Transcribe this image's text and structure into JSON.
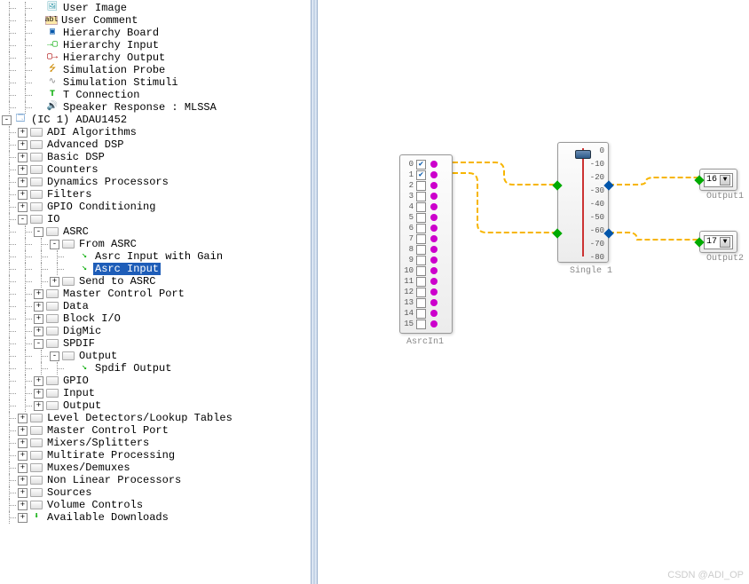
{
  "tree": {
    "misc": [
      {
        "icon": "img",
        "label": "User Image"
      },
      {
        "icon": "abl",
        "label": "User Comment"
      },
      {
        "icon": "hb",
        "label": "Hierarchy Board"
      },
      {
        "icon": "hi",
        "label": "Hierarchy Input"
      },
      {
        "icon": "ho",
        "label": "Hierarchy Output"
      },
      {
        "icon": "sp",
        "label": "Simulation Probe"
      },
      {
        "icon": "ss",
        "label": "Simulation Stimuli"
      },
      {
        "icon": "tc",
        "label": "T Connection"
      },
      {
        "icon": "spk",
        "label": "Speaker Response : MLSSA"
      }
    ],
    "chip": {
      "label": "(IC 1) ADAU1452",
      "exp": "-"
    },
    "chip_children": [
      {
        "exp": "+",
        "label": "ADI Algorithms"
      },
      {
        "exp": "+",
        "label": "Advanced DSP"
      },
      {
        "exp": "+",
        "label": "Basic DSP"
      },
      {
        "exp": "+",
        "label": "Counters"
      },
      {
        "exp": "+",
        "label": "Dynamics Processors"
      },
      {
        "exp": "+",
        "label": "Filters"
      },
      {
        "exp": "+",
        "label": "GPIO Conditioning"
      }
    ],
    "io": {
      "exp": "-",
      "label": "IO"
    },
    "asrc": {
      "exp": "-",
      "label": "ASRC"
    },
    "from_asrc": {
      "exp": "-",
      "label": "From ASRC"
    },
    "asrc_gain": {
      "label": "Asrc Input with Gain"
    },
    "asrc_input": {
      "label": "Asrc Input"
    },
    "send_asrc": {
      "exp": "+",
      "label": "Send to ASRC"
    },
    "io_tail": [
      {
        "exp": "+",
        "label": "Master Control Port"
      },
      {
        "exp": "+",
        "label": "Data"
      },
      {
        "exp": "+",
        "label": "Block I/O"
      },
      {
        "exp": "+",
        "label": "DigMic"
      }
    ],
    "spdif": {
      "exp": "-",
      "label": "SPDIF"
    },
    "spdif_out": {
      "exp": "-",
      "label": "Output"
    },
    "spdif_output_leaf": {
      "label": "Spdif Output"
    },
    "io_tail2": [
      {
        "exp": "+",
        "label": "GPIO"
      },
      {
        "exp": "+",
        "label": "Input"
      },
      {
        "exp": "+",
        "label": "Output"
      }
    ],
    "chip_tail": [
      {
        "exp": "+",
        "label": "Level Detectors/Lookup Tables"
      },
      {
        "exp": "+",
        "label": "Master Control Port"
      },
      {
        "exp": "+",
        "label": "Mixers/Splitters"
      },
      {
        "exp": "+",
        "label": "Multirate Processing"
      },
      {
        "exp": "+",
        "label": "Muxes/Demuxes"
      },
      {
        "exp": "+",
        "label": "Non Linear Processors"
      },
      {
        "exp": "+",
        "label": "Sources"
      },
      {
        "exp": "+",
        "label": "Volume Controls"
      },
      {
        "exp": "+",
        "label": "Available Downloads",
        "icon": "dl"
      }
    ]
  },
  "canvas": {
    "asrcin": {
      "label": "AsrcIn1",
      "channels": [
        {
          "n": "0",
          "checked": true
        },
        {
          "n": "1",
          "checked": true
        },
        {
          "n": "2",
          "checked": false
        },
        {
          "n": "3",
          "checked": false
        },
        {
          "n": "4",
          "checked": false
        },
        {
          "n": "5",
          "checked": false
        },
        {
          "n": "6",
          "checked": false
        },
        {
          "n": "7",
          "checked": false
        },
        {
          "n": "8",
          "checked": false
        },
        {
          "n": "9",
          "checked": false
        },
        {
          "n": "10",
          "checked": false
        },
        {
          "n": "11",
          "checked": false
        },
        {
          "n": "12",
          "checked": false
        },
        {
          "n": "13",
          "checked": false
        },
        {
          "n": "14",
          "checked": false
        },
        {
          "n": "15",
          "checked": false
        }
      ]
    },
    "single": {
      "label": "Single 1",
      "ticks": [
        "0",
        "-10",
        "-20",
        "-30",
        "-40",
        "-50",
        "-60",
        "-70",
        "-80"
      ]
    },
    "out1": {
      "label": "Output1",
      "value": "16"
    },
    "out2": {
      "label": "Output2",
      "value": "17"
    }
  },
  "watermark": "CSDN @ADI_OP"
}
